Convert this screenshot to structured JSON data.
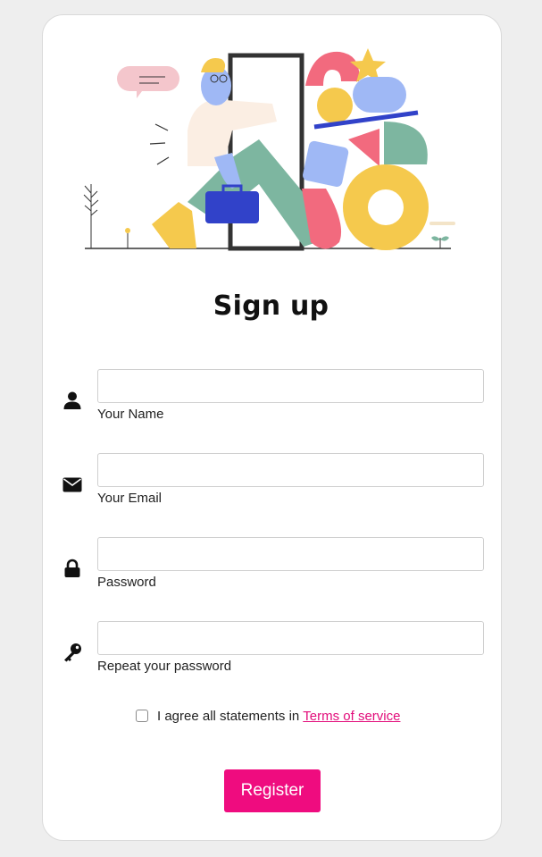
{
  "page": {
    "title": "Sign up"
  },
  "form": {
    "fields": [
      {
        "label": "Your Name",
        "icon": "user-icon",
        "value": "",
        "placeholder": ""
      },
      {
        "label": "Your Email",
        "icon": "envelope-icon",
        "value": "",
        "placeholder": ""
      },
      {
        "label": "Password",
        "icon": "lock-icon",
        "value": "",
        "placeholder": ""
      },
      {
        "label": "Repeat your password",
        "icon": "key-icon",
        "value": "",
        "placeholder": ""
      }
    ],
    "agree_text": "I agree all statements in",
    "terms_link": "Terms of service",
    "agree_checked": false,
    "register_label": "Register"
  },
  "colors": {
    "accent": "#ef0c7f",
    "link": "#e20c7a",
    "background": "#eeeeee",
    "card": "#ffffff"
  }
}
